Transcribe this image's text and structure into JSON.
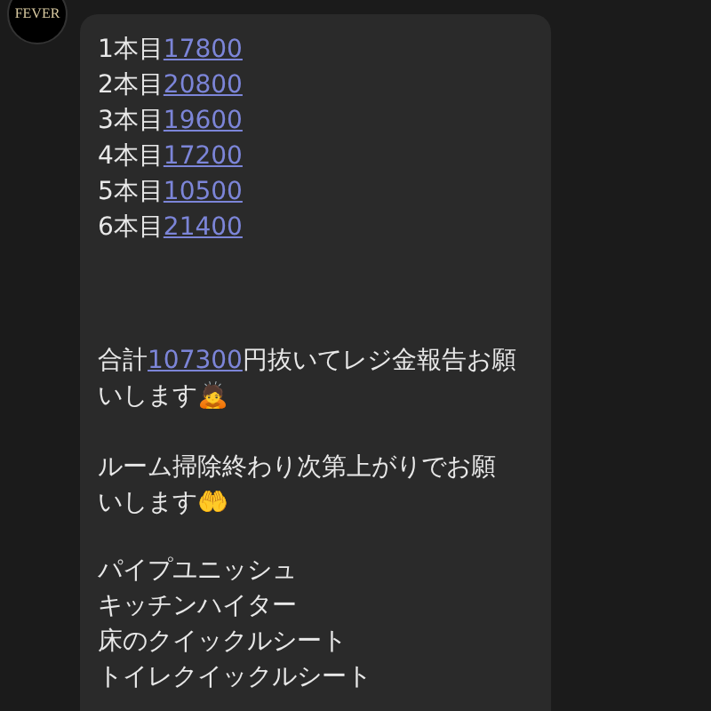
{
  "message": {
    "avatar_text": "FEVER",
    "counts": [
      {
        "label": "1本目",
        "amount": "17800"
      },
      {
        "label": "2本目",
        "amount": "20800"
      },
      {
        "label": "3本目",
        "amount": "19600"
      },
      {
        "label": "4本目",
        "amount": "17200"
      },
      {
        "label": "5本目",
        "amount": "10500"
      },
      {
        "label": "6本目",
        "amount": "21400"
      }
    ],
    "total": {
      "before": "合計",
      "amount": "107300",
      "after": "円抜いてレジ金報告お願いします🙇"
    },
    "request": "ルーム掃除終わり次第上がりでお願いします🤲",
    "supplies": [
      "パイプユニッシュ",
      "キッチンハイター",
      "床のクイックルシート",
      "トイレクイックルシート"
    ]
  }
}
